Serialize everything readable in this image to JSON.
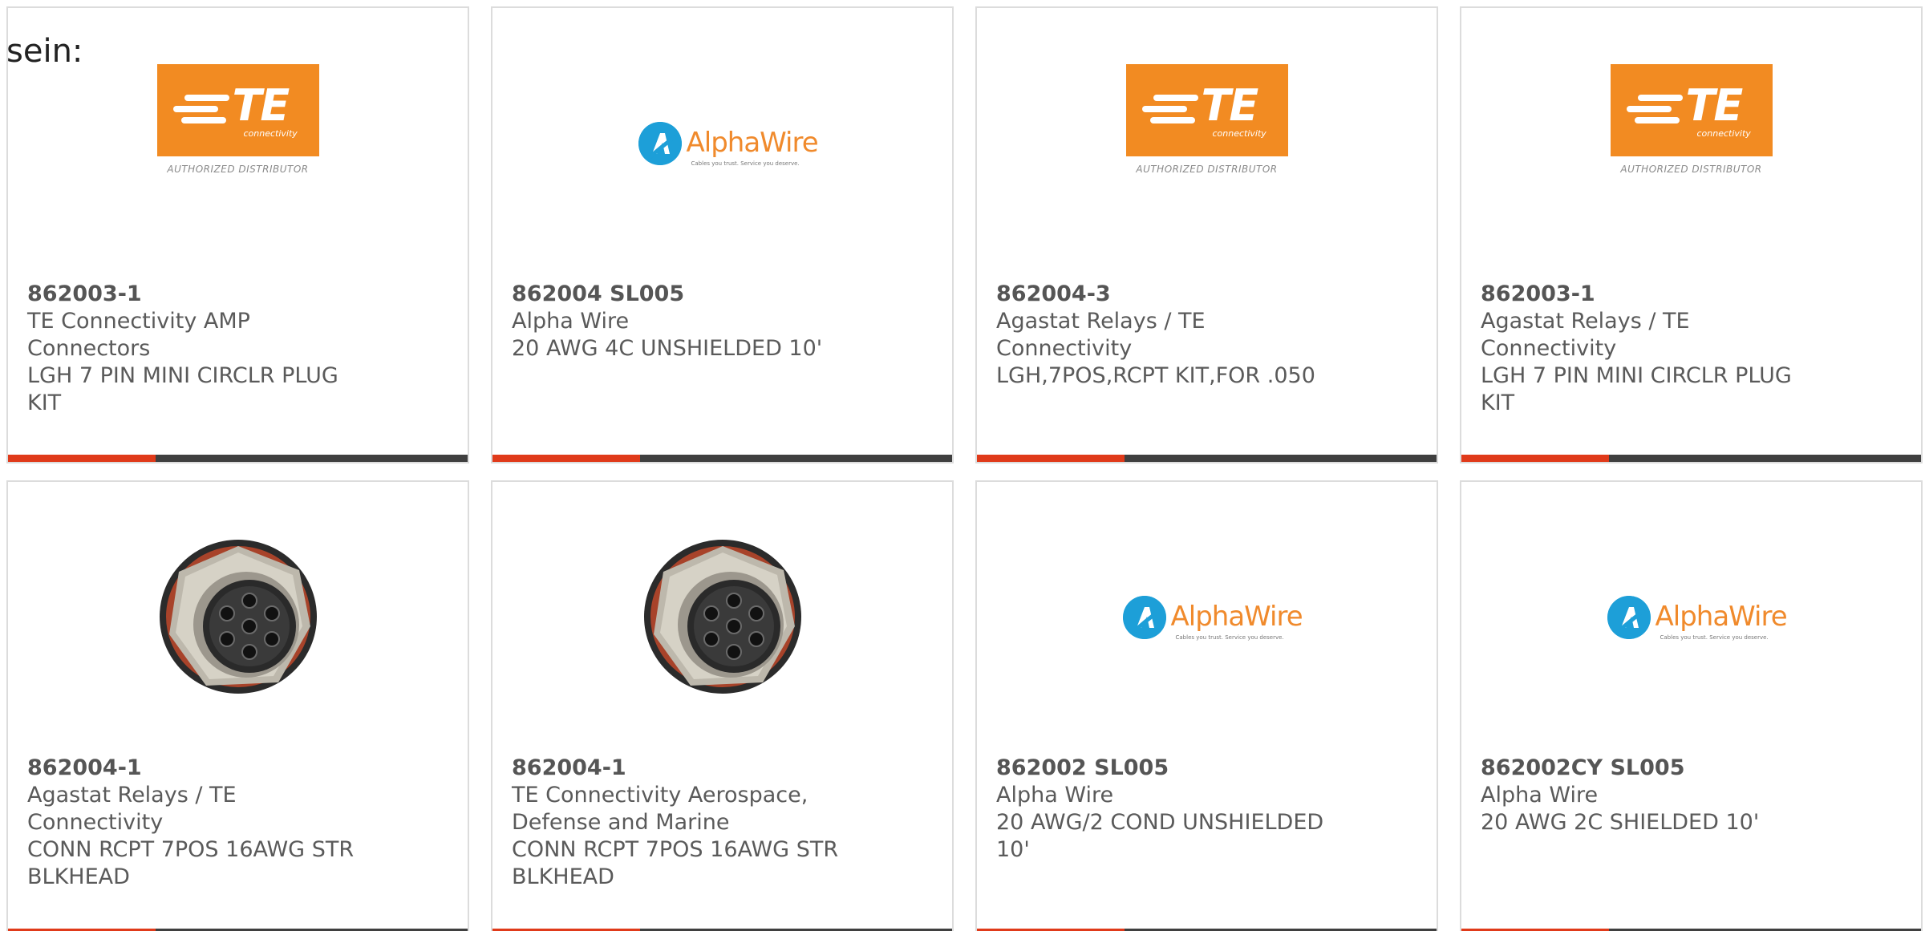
{
  "intro_text": "sein:",
  "logos": {
    "te": {
      "wordmark": "TE",
      "subtitle": "connectivity",
      "distributor": "AUTHORIZED DISTRIBUTOR",
      "colors": {
        "background": "#f28b22",
        "text": "#ffffff"
      }
    },
    "alphawire": {
      "wordmark": "AlphaWire",
      "tagline": "Cables you trust. Service you deserve.",
      "colors": {
        "circle": "#1d9fd8",
        "wordmark": "#f08a2c"
      }
    }
  },
  "accent_color": "#e03a1a",
  "products": [
    {
      "logo": "te-logo",
      "part_number": "862003-1",
      "manufacturer": "TE Connectivity AMP Connectors",
      "description": "LGH 7 PIN MINI CIRCLR PLUG KIT"
    },
    {
      "logo": "alphawire-logo",
      "part_number": "862004 SL005",
      "manufacturer": "Alpha Wire",
      "description": "20 AWG 4C UNSHIELDED 10'"
    },
    {
      "logo": "te-logo",
      "part_number": "862004-3",
      "manufacturer": "Agastat Relays / TE Connectivity",
      "description": "LGH,7POS,RCPT KIT,FOR .050"
    },
    {
      "logo": "te-logo",
      "part_number": "862003-1",
      "manufacturer": "Agastat Relays / TE Connectivity",
      "description": "LGH 7 PIN MINI CIRCLR PLUG KIT"
    },
    {
      "logo": "connector-image",
      "part_number": "862004-1",
      "manufacturer": "Agastat Relays / TE Connectivity",
      "description": "CONN RCPT 7POS 16AWG STR BLKHEAD"
    },
    {
      "logo": "connector-image",
      "part_number": "862004-1",
      "manufacturer": "TE Connectivity Aerospace, Defense and Marine",
      "description": "CONN RCPT 7POS 16AWG STR BLKHEAD"
    },
    {
      "logo": "alphawire-logo",
      "part_number": "862002 SL005",
      "manufacturer": "Alpha Wire",
      "description": "20 AWG/2 COND UNSHIELDED 10'"
    },
    {
      "logo": "alphawire-logo",
      "part_number": "862002CY SL005",
      "manufacturer": "Alpha Wire",
      "description": "20 AWG 2C SHIELDED 10'"
    }
  ]
}
